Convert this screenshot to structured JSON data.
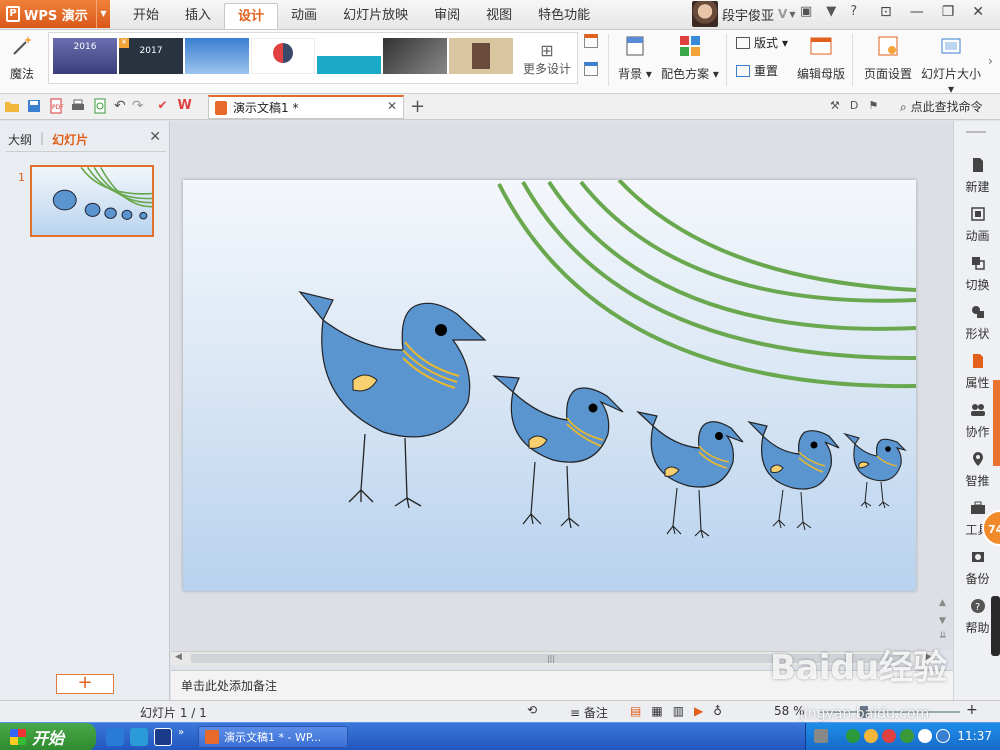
{
  "app": {
    "name": "WPS 演示",
    "tabs": [
      "开始",
      "插入",
      "设计",
      "动画",
      "幻灯片放映",
      "审阅",
      "视图",
      "特色功能"
    ],
    "active_tab": "设计",
    "user": "段宇俊亚",
    "vip": "V"
  },
  "ribbon": {
    "magic": "魔法",
    "more_design": "更多设计",
    "background": "背景",
    "color_scheme": "配色方案",
    "layout": "版式",
    "reset": "重置",
    "edit_master": "编辑母版",
    "page_setup": "页面设置",
    "slide_size": "幻灯片大小",
    "themes": [
      {
        "label": "2016",
        "bg": "#4a4f8c"
      },
      {
        "label": "2017",
        "bg": "#2a3440"
      },
      {
        "label": "",
        "bg": "#3a7fd0"
      },
      {
        "label": "",
        "bg": "#ffffff"
      },
      {
        "label": "",
        "bg": "#1aa9c8"
      },
      {
        "label": "",
        "bg": "#555a60"
      },
      {
        "label": "",
        "bg": "#d9c6a0"
      }
    ]
  },
  "document": {
    "tab_title": "演示文稿1 *",
    "search_placeholder": "点此查找命令"
  },
  "left_panel": {
    "tab_outline": "大纲",
    "tab_slides": "幻灯片",
    "slide_number": "1"
  },
  "notes": {
    "placeholder": "单击此处添加备注"
  },
  "right_rail": {
    "items": [
      "新建",
      "动画",
      "切换",
      "形状",
      "属性",
      "协作",
      "智推",
      "工具",
      "备份",
      "帮助"
    ],
    "badge": "74"
  },
  "status": {
    "slide_count": "幻灯片 1 / 1",
    "notes_label": "备注",
    "zoom": "58 %"
  },
  "taskbar": {
    "start": "开始",
    "task_label": "演示文稿1 * - WP...",
    "clock": "11:37"
  },
  "watermark": {
    "brand": "Baidu经验",
    "url": "jingyan.baidu.com"
  },
  "colors": {
    "accent": "#e0601c",
    "bird_body": "#5b95d0",
    "bird_wing": "#f8d070",
    "collar": "#e8b830",
    "arc_green": "#6aa84f"
  }
}
